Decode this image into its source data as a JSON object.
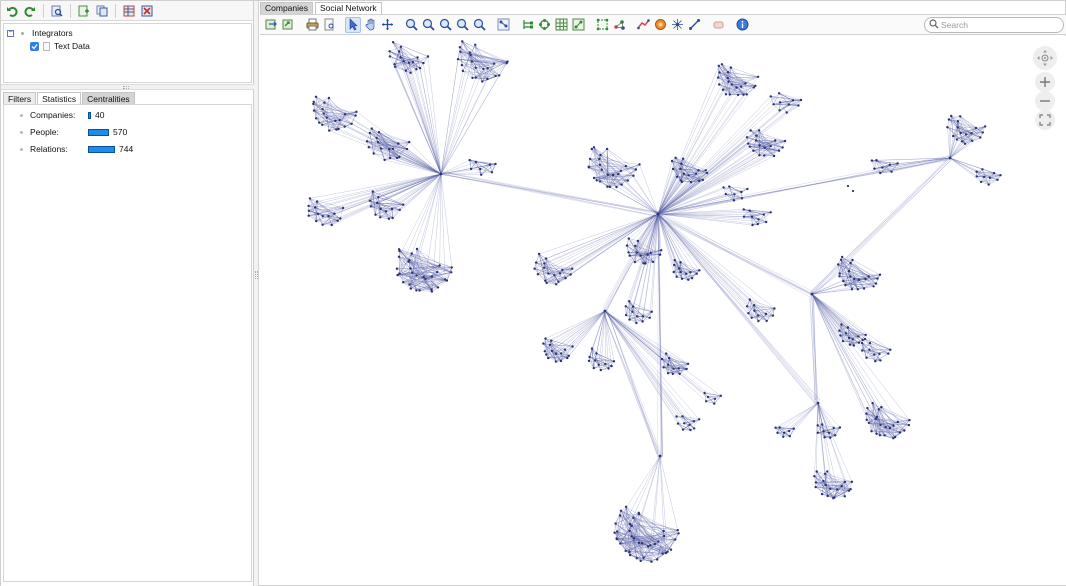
{
  "left_panel": {
    "tree": {
      "root_label": "Integrators",
      "child_label": "Text Data",
      "root_toggle": "−"
    },
    "tabs": [
      {
        "label": "Filters"
      },
      {
        "label": "Statistics"
      },
      {
        "label": "Centralities"
      }
    ],
    "statistics": [
      {
        "label": "Companies:",
        "value": "40",
        "fraction": 0.054
      },
      {
        "label": "People:",
        "value": "570",
        "fraction": 0.766
      },
      {
        "label": "Relations:",
        "value": "744",
        "fraction": 1.0
      }
    ]
  },
  "right_panel": {
    "tabs": [
      {
        "label": "Companies"
      },
      {
        "label": "Social Network"
      }
    ],
    "search": {
      "placeholder": "Search"
    }
  },
  "colors": {
    "edge": "#5a63a8",
    "node": "#2b3270",
    "stat_bar": "#1f8ce8",
    "checkbox": "#2d7ee8"
  }
}
